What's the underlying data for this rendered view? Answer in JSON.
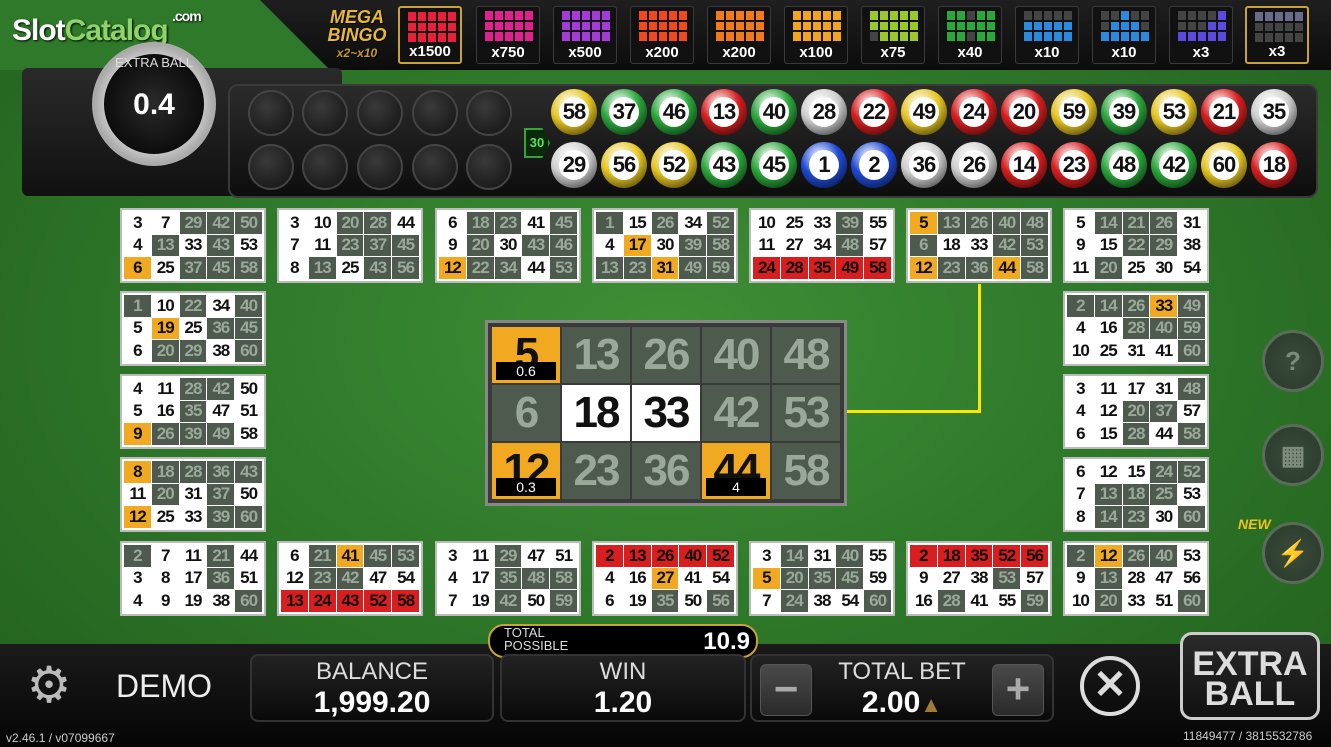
{
  "logo": {
    "main": "Slot",
    "accent": "Catalog",
    "suffix": ".com"
  },
  "mega": {
    "line1": "MEGA",
    "line2": "BINGO",
    "line3": "x2~x10"
  },
  "patterns": [
    {
      "color": "#e8203a",
      "mult": "x1500",
      "cells": [
        1,
        1,
        1,
        1,
        1,
        1,
        1,
        1,
        1,
        1,
        1,
        1,
        1,
        1,
        1
      ],
      "selected": true
    },
    {
      "color": "#e0208c",
      "mult": "x750",
      "cells": [
        1,
        1,
        1,
        1,
        1,
        1,
        1,
        1,
        1,
        1,
        1,
        1,
        1,
        1,
        1
      ]
    },
    {
      "color": "#a43ad8",
      "mult": "x500",
      "cells": [
        1,
        1,
        1,
        1,
        1,
        1,
        1,
        1,
        1,
        1,
        1,
        1,
        1,
        1,
        1
      ]
    },
    {
      "color": "#f04a1c",
      "mult": "x200",
      "cells": [
        1,
        1,
        1,
        1,
        1,
        1,
        1,
        1,
        1,
        1,
        1,
        1,
        1,
        1,
        1
      ]
    },
    {
      "color": "#f07a1c",
      "mult": "x200",
      "cells": [
        1,
        1,
        1,
        1,
        1,
        1,
        1,
        1,
        1,
        1,
        1,
        1,
        1,
        1,
        1
      ]
    },
    {
      "color": "#f2a51c",
      "mult": "x100",
      "cells": [
        1,
        1,
        1,
        1,
        1,
        1,
        1,
        1,
        1,
        1,
        1,
        1,
        1,
        1,
        1
      ]
    },
    {
      "color": "#9ac82a",
      "mult": "x75",
      "cells": [
        1,
        1,
        1,
        1,
        1,
        1,
        1,
        1,
        1,
        1,
        0,
        1,
        1,
        1,
        1
      ]
    },
    {
      "color": "#2aa83a",
      "mult": "x40",
      "cells": [
        1,
        1,
        0,
        1,
        1,
        1,
        1,
        1,
        1,
        1,
        1,
        1,
        0,
        1,
        1
      ]
    },
    {
      "color": "#2a8ae0",
      "mult": "x10",
      "cells": [
        0,
        0,
        0,
        0,
        0,
        1,
        1,
        1,
        1,
        1,
        1,
        1,
        1,
        1,
        1
      ]
    },
    {
      "color": "#2a8ae0",
      "mult": "x10",
      "cells": [
        0,
        0,
        1,
        0,
        0,
        0,
        1,
        1,
        1,
        0,
        1,
        1,
        1,
        1,
        1
      ]
    },
    {
      "color": "#5a4ae0",
      "mult": "x3",
      "cells": [
        0,
        0,
        0,
        0,
        1,
        0,
        0,
        0,
        1,
        1,
        1,
        1,
        1,
        1,
        1
      ]
    },
    {
      "color": "#6a6a8a",
      "mult": "x3",
      "cells": [
        1,
        1,
        1,
        1,
        1,
        0,
        0,
        0,
        0,
        0,
        0,
        0,
        0,
        0,
        0
      ],
      "selected": true
    }
  ],
  "gauge": {
    "label": "EXTRA BALL",
    "value": "0.4"
  },
  "ball_count": "30",
  "balls": [
    {
      "n": "58",
      "c": "#e6c622"
    },
    {
      "n": "37",
      "c": "#2aa83a"
    },
    {
      "n": "46",
      "c": "#2aa83a"
    },
    {
      "n": "13",
      "c": "#d81e1e"
    },
    {
      "n": "40",
      "c": "#2aa83a"
    },
    {
      "n": "28",
      "c": "#cfcfcf"
    },
    {
      "n": "22",
      "c": "#d81e1e"
    },
    {
      "n": "49",
      "c": "#e6c622"
    },
    {
      "n": "24",
      "c": "#d81e1e"
    },
    {
      "n": "20",
      "c": "#d81e1e"
    },
    {
      "n": "59",
      "c": "#e6c622"
    },
    {
      "n": "39",
      "c": "#2aa83a"
    },
    {
      "n": "53",
      "c": "#e6c622"
    },
    {
      "n": "21",
      "c": "#d81e1e"
    },
    {
      "n": "35",
      "c": "#cfcfcf"
    },
    {
      "n": "29",
      "c": "#cfcfcf"
    },
    {
      "n": "56",
      "c": "#e6c622"
    },
    {
      "n": "52",
      "c": "#e6c622"
    },
    {
      "n": "43",
      "c": "#2aa83a"
    },
    {
      "n": "45",
      "c": "#2aa83a"
    },
    {
      "n": "1",
      "c": "#1e4ad8"
    },
    {
      "n": "2",
      "c": "#1e4ad8"
    },
    {
      "n": "36",
      "c": "#cfcfcf"
    },
    {
      "n": "26",
      "c": "#cfcfcf"
    },
    {
      "n": "14",
      "c": "#d81e1e"
    },
    {
      "n": "23",
      "c": "#d81e1e"
    },
    {
      "n": "48",
      "c": "#2aa83a"
    },
    {
      "n": "42",
      "c": "#2aa83a"
    },
    {
      "n": "60",
      "c": "#e6c622"
    },
    {
      "n": "18",
      "c": "#d81e1e"
    }
  ],
  "cards": [
    {
      "nums": [
        "3",
        "7",
        "29",
        "42",
        "50",
        "4",
        "13",
        "33",
        "43",
        "53",
        "6",
        "25",
        "37",
        "45",
        "58"
      ],
      "st": "wwgggwgwgwywggg"
    },
    {
      "nums": [
        "3",
        "10",
        "20",
        "28",
        "44",
        "7",
        "11",
        "23",
        "37",
        "45",
        "8",
        "13",
        "25",
        "43",
        "56"
      ],
      "st": "wwggwwwgggwgwgg"
    },
    {
      "nums": [
        "6",
        "18",
        "23",
        "41",
        "45",
        "9",
        "20",
        "30",
        "43",
        "46",
        "12",
        "22",
        "34",
        "44",
        "53"
      ],
      "st": "wggwgwgwggyggwg"
    },
    {
      "nums": [
        "1",
        "15",
        "26",
        "34",
        "52",
        "4",
        "17",
        "30",
        "39",
        "58",
        "13",
        "23",
        "31",
        "49",
        "59"
      ],
      "st": "gwgwgwywggggygg"
    },
    {
      "nums": [
        "10",
        "25",
        "33",
        "39",
        "55",
        "11",
        "27",
        "34",
        "48",
        "57",
        "24",
        "28",
        "35",
        "49",
        "58"
      ],
      "st": "wwwgwwwwgwrrrrr"
    },
    {
      "nums": [
        "5",
        "13",
        "26",
        "40",
        "48",
        "6",
        "18",
        "33",
        "42",
        "53",
        "12",
        "23",
        "36",
        "44",
        "58"
      ],
      "st": "ygggggwwggyggyg"
    },
    {
      "nums": [
        "5",
        "14",
        "21",
        "26",
        "31",
        "9",
        "15",
        "22",
        "29",
        "38",
        "11",
        "20",
        "25",
        "30",
        "54"
      ],
      "st": "wgggwwwggwwgwww"
    },
    {
      "nums": [
        "1",
        "10",
        "22",
        "34",
        "40",
        "5",
        "19",
        "25",
        "36",
        "45",
        "6",
        "20",
        "29",
        "38",
        "60"
      ],
      "st": "gwgwgwywggwggwg"
    },
    {
      "nums": [
        "4",
        "11",
        "28",
        "42",
        "50",
        "5",
        "16",
        "35",
        "47",
        "51",
        "9",
        "26",
        "39",
        "49",
        "58"
      ],
      "st": "wwggwwwgwwyggg"
    },
    {
      "nums": [
        "8",
        "18",
        "28",
        "36",
        "43",
        "11",
        "20",
        "31",
        "37",
        "50",
        "12",
        "25",
        "33",
        "39",
        "60"
      ],
      "st": "yggggwgwgwywwgg"
    },
    {
      "nums": [
        "2",
        "14",
        "26",
        "33",
        "49",
        "4",
        "16",
        "28",
        "40",
        "59",
        "10",
        "25",
        "31",
        "41",
        "60"
      ],
      "st": "gggygwwgggwwwwg"
    },
    {
      "nums": [
        "3",
        "11",
        "17",
        "31",
        "48",
        "4",
        "12",
        "20",
        "37",
        "57",
        "6",
        "15",
        "28",
        "44",
        "58"
      ],
      "st": "wwwwgwwggwwwgwg"
    },
    {
      "nums": [
        "6",
        "12",
        "15",
        "24",
        "52",
        "7",
        "13",
        "18",
        "25",
        "53",
        "8",
        "14",
        "23",
        "30",
        "60"
      ],
      "st": "wwwggwgggwwggwg"
    },
    {
      "nums": [
        "2",
        "7",
        "11",
        "21",
        "44",
        "3",
        "8",
        "17",
        "36",
        "51",
        "4",
        "9",
        "19",
        "38",
        "60"
      ],
      "st": "gwwgwwwwgwwwwwg"
    },
    {
      "nums": [
        "6",
        "21",
        "41",
        "45",
        "53",
        "12",
        "23",
        "42",
        "47",
        "54",
        "13",
        "24",
        "43",
        "52",
        "58"
      ],
      "st": "wgyggwggwwrrrrr"
    },
    {
      "nums": [
        "3",
        "11",
        "29",
        "47",
        "51",
        "4",
        "17",
        "35",
        "48",
        "58",
        "7",
        "19",
        "42",
        "50",
        "59"
      ],
      "st": "wwgwwwwgggwwgwg"
    },
    {
      "nums": [
        "2",
        "13",
        "26",
        "40",
        "52",
        "4",
        "16",
        "27",
        "41",
        "54",
        "6",
        "19",
        "35",
        "50",
        "56"
      ],
      "st": "rrrrrwwywwwwgwg"
    },
    {
      "nums": [
        "3",
        "14",
        "31",
        "40",
        "55",
        "5",
        "20",
        "35",
        "45",
        "59",
        "7",
        "24",
        "38",
        "54",
        "60"
      ],
      "st": "wgwgwygggwwgwwg"
    },
    {
      "nums": [
        "2",
        "18",
        "35",
        "52",
        "56",
        "9",
        "27",
        "38",
        "53",
        "57",
        "16",
        "28",
        "41",
        "55",
        "59"
      ],
      "st": "rrrrrwwwgwwgwwg"
    },
    {
      "nums": [
        "2",
        "12",
        "26",
        "40",
        "53",
        "9",
        "13",
        "28",
        "47",
        "56",
        "10",
        "20",
        "33",
        "51",
        "60"
      ],
      "st": "gyggwwgwwwwgwwg"
    }
  ],
  "bigcard": {
    "nums": [
      "5",
      "13",
      "26",
      "40",
      "48",
      "6",
      "18",
      "33",
      "42",
      "53",
      "12",
      "23",
      "36",
      "44",
      "58"
    ],
    "st": "ygggggwwggyggyg",
    "pays": {
      "0": "0.6",
      "10": "0.3",
      "13": "4"
    }
  },
  "side": {
    "new": "NEW",
    "help": "?",
    "grid": "▦",
    "lightning": "⚡"
  },
  "total_possible": {
    "label": "TOTAL POSSIBLE",
    "value": "10.9"
  },
  "demo": "DEMO",
  "balance": {
    "label": "BALANCE",
    "value": "1,999.20"
  },
  "win": {
    "label": "WIN",
    "value": "1.20"
  },
  "bet": {
    "label": "TOTAL BET",
    "value": "2.00",
    "minus": "−",
    "plus": "+"
  },
  "extra_ball_button": {
    "line1": "EXTRA",
    "line2": "BALL"
  },
  "close": "✕",
  "version": "v2.46.1 / v07099667",
  "ids": "11849477 / 3815532786",
  "icons": {
    "settings": "gear-icon",
    "close": "close-icon",
    "triangle": "triangle-up-icon"
  }
}
